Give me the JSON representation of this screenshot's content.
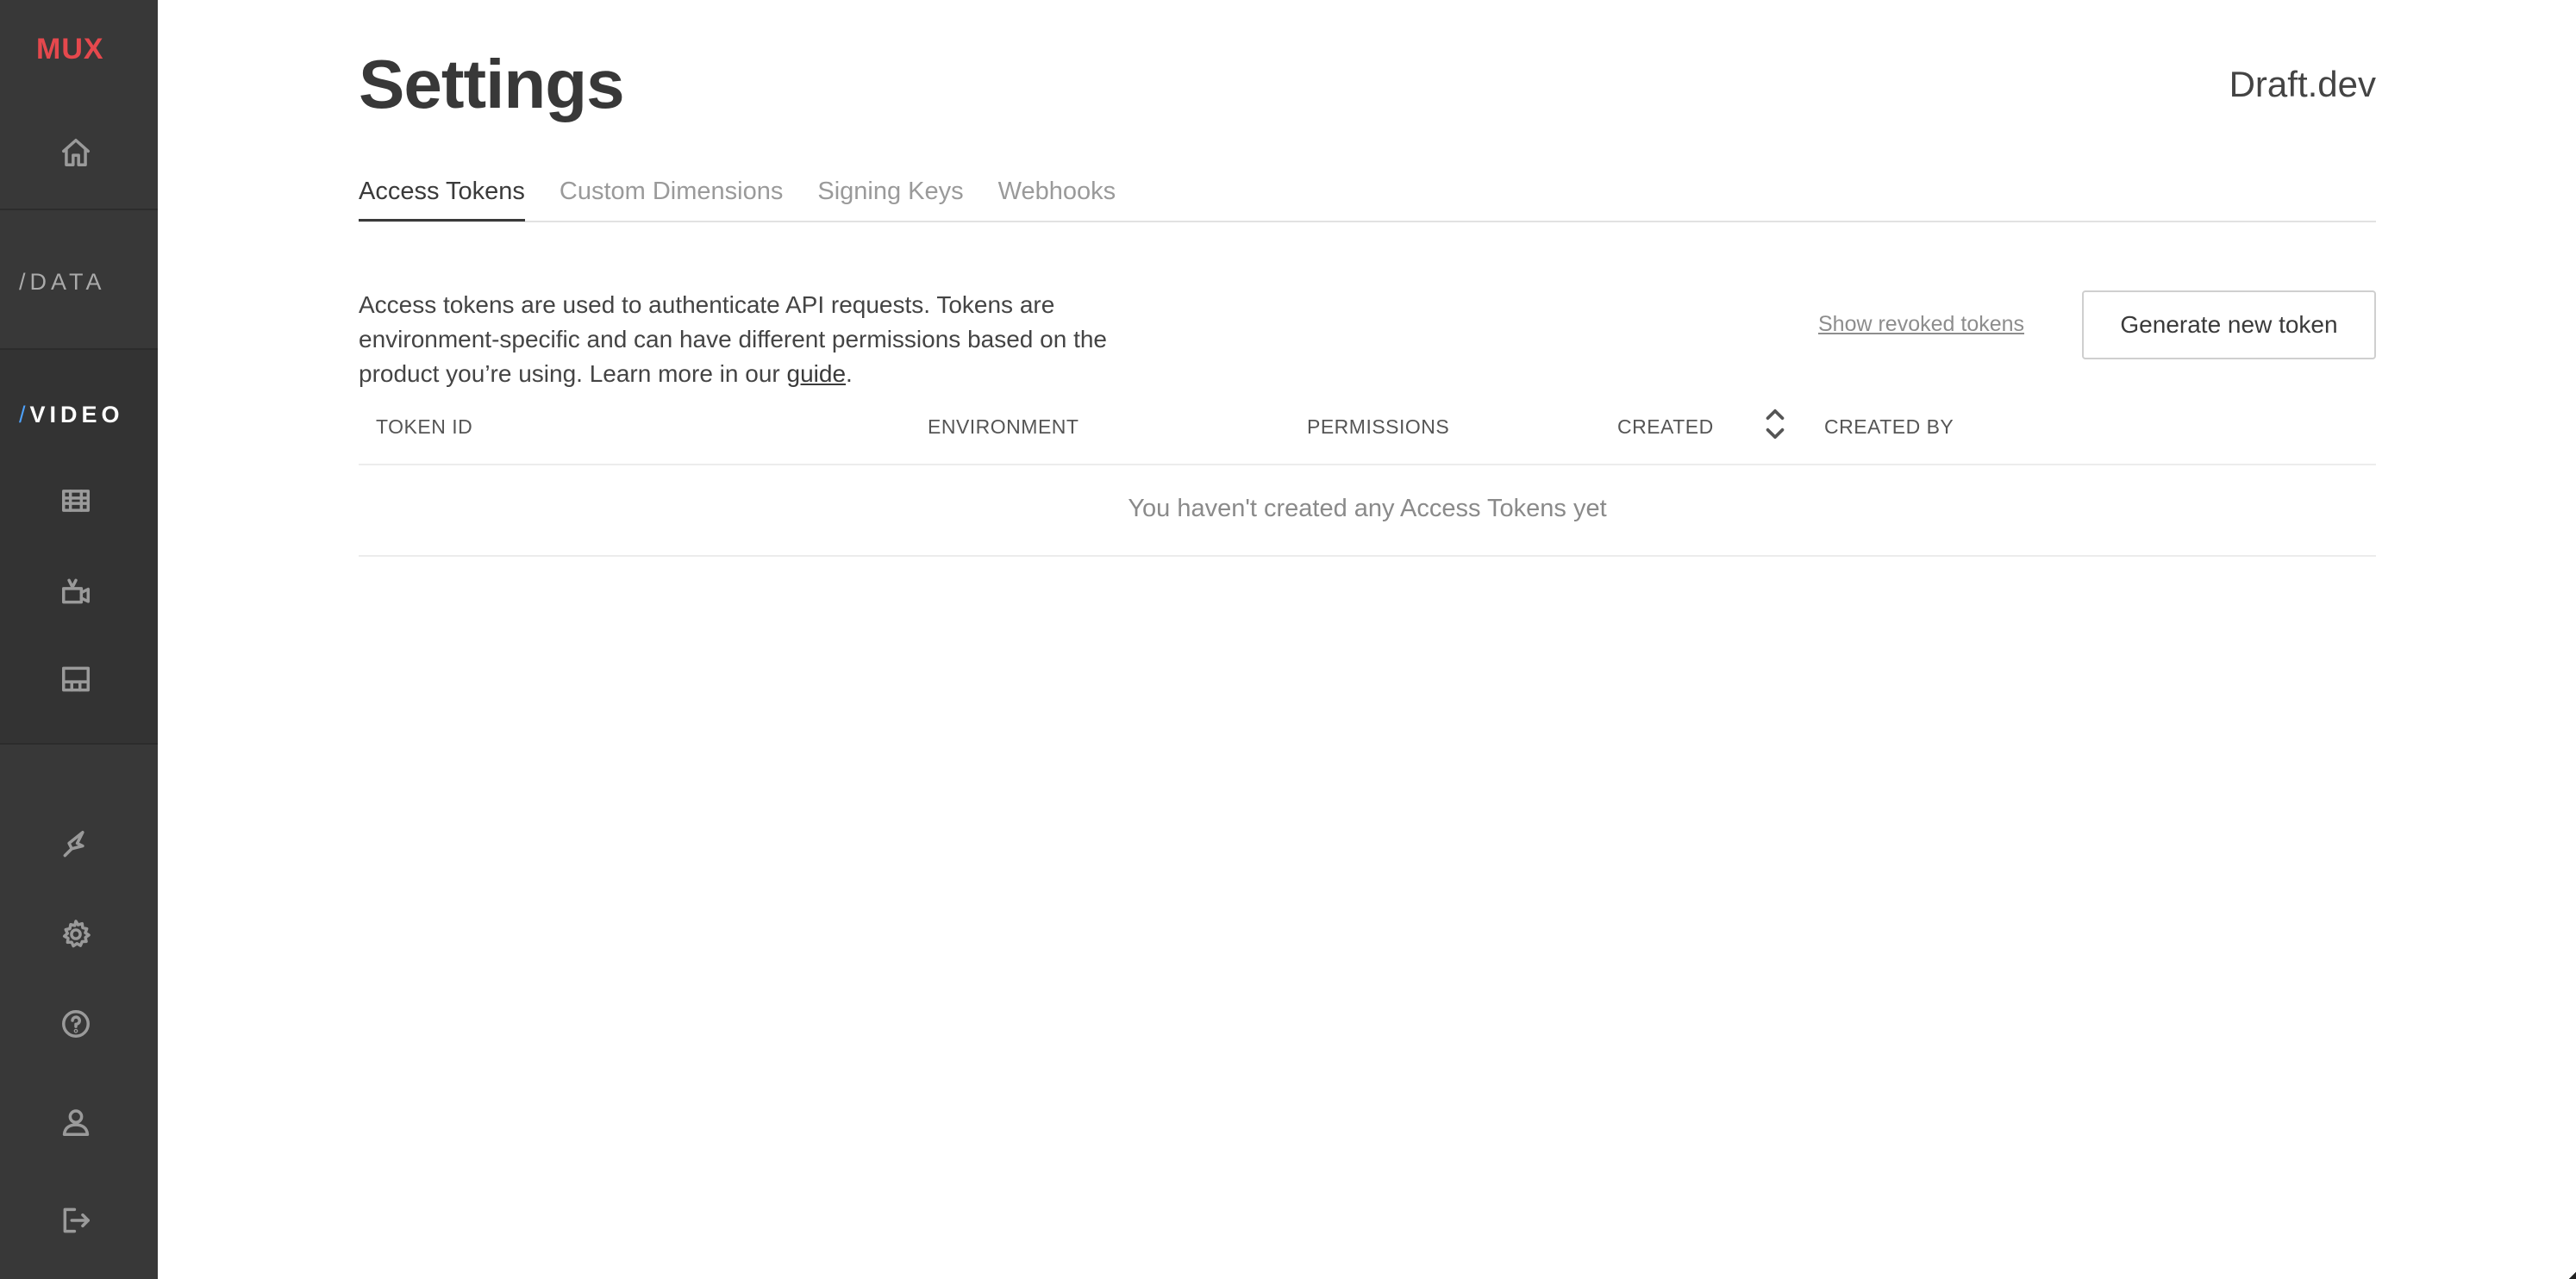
{
  "sidebar": {
    "logo": "MUX",
    "sections": {
      "data_slash": "/",
      "data": "DATA",
      "video_slash": "/",
      "video": "VIDEO"
    },
    "icons": [
      "home-icon",
      "assets-icon",
      "live-stream-icon",
      "player-icon",
      "integrations-icon",
      "gear-icon",
      "help-icon",
      "user-icon",
      "logout-icon"
    ]
  },
  "header": {
    "title": "Settings",
    "org": "Draft.dev"
  },
  "tabs": [
    {
      "label": "Access Tokens",
      "active": true
    },
    {
      "label": "Custom Dimensions",
      "active": false
    },
    {
      "label": "Signing Keys",
      "active": false
    },
    {
      "label": "Webhooks",
      "active": false
    }
  ],
  "main": {
    "description": "Access tokens are used to authenticate API requests. Tokens are environment-specific and can have different permissions based on the product you’re using. Learn more in our ",
    "description_link": "guide",
    "description_end": ".",
    "show_revoked": "Show revoked tokens",
    "generate_button": "Generate new token"
  },
  "table": {
    "columns": [
      "TOKEN ID",
      "ENVIRONMENT",
      "PERMISSIONS",
      "CREATED",
      "CREATED BY"
    ],
    "empty_message": "You haven't created any Access Tokens yet"
  }
}
